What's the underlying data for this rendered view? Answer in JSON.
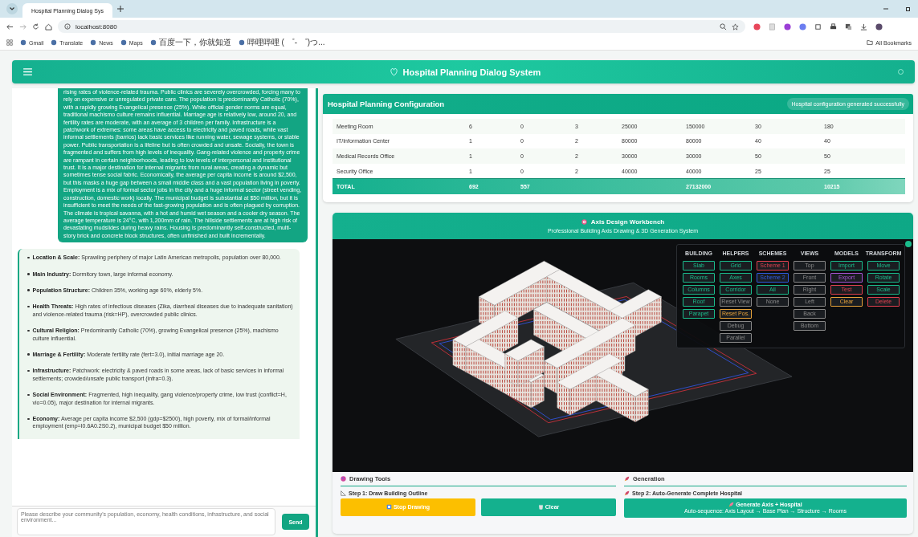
{
  "browser": {
    "tab_title": "Hospital Planning Dialog Sys",
    "address": "localhost:8080",
    "bookmarks": [
      {
        "label": "Gmail"
      },
      {
        "label": "Translate"
      },
      {
        "label": "News"
      },
      {
        "label": "Maps"
      },
      {
        "label": "百度一下，你就知道"
      },
      {
        "label": "哔哩哔哩 ( ゜- ゜)つ..."
      }
    ],
    "all_bookmarks": "All Bookmarks"
  },
  "app": {
    "title": "Hospital Planning Dialog System"
  },
  "chat": {
    "user_message": "rising rates of violence-related trauma. Public clinics are severely overcrowded, forcing many to rely on expensive or unregulated private care. The population is predominantly Catholic (70%), with a rapidly growing Evangelical presence (25%). While official gender norms are equal, traditional machismo culture remains influential. Marriage age is relatively low, around 20, and fertility rates are moderate, with an average of 3 children per family. Infrastructure is a patchwork of extremes: some areas have access to electricity and paved roads, while vast informal settlements (barrios) lack basic services like running water, sewage systems, or stable power. Public transportation is a lifeline but is often crowded and unsafe. Socially, the town is fragmented and suffers from high levels of inequality. Gang-related violence and property crime are rampant in certain neighborhoods, leading to low levels of interpersonal and institutional trust. It is a major destination for internal migrants from rural areas, creating a dynamic but sometimes tense social fabric. Economically, the average per capita income is around $2,500, but this masks a huge gap between a small middle class and a vast population living in poverty. Employment is a mix of formal sector jobs in the city and a huge informal sector (street vending, construction, domestic work) locally. The municipal budget is substantial at $50 million, but it is insufficient to meet the needs of the fast-growing population and is often plagued by corruption. The climate is tropical savanna, with a hot and humid wet season and a cooler dry season. The average temperature is 24°C, with 1,200mm of rain. The hillside settlements are at high risk of devastating mudslides during heavy rains. Housing is predominantly self-constructed, multi-story brick and concrete block structures, often unfinished and built incrementally.",
    "summary": [
      {
        "label": "Location & Scale:",
        "text": "Sprawling periphery of major Latin American metropolis, population over 80,000."
      },
      {
        "label": "Main Industry:",
        "text": "Dormitory town, large informal economy."
      },
      {
        "label": "Population Structure:",
        "text": "Children 35%, working age 60%, elderly 5%."
      },
      {
        "label": "Health Threats:",
        "text": "High rates of infectious diseases (Zika, diarrheal diseases due to inadequate sanitation) and violence-related trauma (risk=HP), overcrowded public clinics."
      },
      {
        "label": "Cultural Religion:",
        "text": "Predominantly Catholic (70%), growing Evangelical presence (25%), machismo culture influential."
      },
      {
        "label": "Marriage & Fertility:",
        "text": "Moderate fertility rate (fert=3.0), initial marriage age 20."
      },
      {
        "label": "Infrastructure:",
        "text": "Patchwork: electricity & paved roads in some areas, lack of basic services in informal settlements; crowded/unsafe public transport (infra=0.3)."
      },
      {
        "label": "Social Environment:",
        "text": "Fragmented, high inequality, gang violence/property crime, low trust (conflict=H, vio=0.05), major destination for internal migrants."
      },
      {
        "label": "Economy:",
        "text": "Average per capita income $2,500 (gdp=$2500), high poverty, mix of formal/informal employment (emp=I0.6A0.2S0.2), municipal budget $50 million."
      }
    ],
    "input": {
      "placeholder": "Please describe your community's population, economy, health conditions, infrastructure, and social environment..."
    },
    "send": "Send"
  },
  "config": {
    "title": "Hospital Planning Configuration",
    "status": "Hospital configuration generated successfully",
    "rows": [
      [
        "Meeting Room",
        "6",
        "0",
        "3",
        "25000",
        "150000",
        "30",
        "180"
      ],
      [
        "IT/Information Center",
        "1",
        "0",
        "2",
        "80000",
        "80000",
        "40",
        "40"
      ],
      [
        "Medical Records Office",
        "1",
        "0",
        "2",
        "30000",
        "30000",
        "50",
        "50"
      ],
      [
        "Security Office",
        "1",
        "0",
        "2",
        "40000",
        "40000",
        "25",
        "25"
      ]
    ],
    "total": {
      "column_1": "TOTAL",
      "column_2": "692",
      "column_3": "557",
      "column_6": "27132000",
      "column_8": "10215"
    }
  },
  "workbench": {
    "title": "Axis Design Workbench",
    "subtitle": "Professional Building Axis Drawing & 3D Generation System",
    "palette": [
      {
        "title": "BUILDING",
        "buttons": [
          {
            "label": "Slab",
            "color": "#1abc8c"
          },
          {
            "label": "Rooms",
            "color": "#1abc8c"
          },
          {
            "label": "Columns",
            "color": "#1abc8c"
          },
          {
            "label": "Roof",
            "color": "#1abc8c"
          },
          {
            "label": "Parapet",
            "color": "#1abc8c"
          }
        ]
      },
      {
        "title": "HELPERS",
        "buttons": [
          {
            "label": "Grid",
            "color": "#1abc8c"
          },
          {
            "label": "Axes",
            "color": "#1abc8c"
          },
          {
            "label": "Corridor",
            "color": "#1abc8c"
          },
          {
            "label": "Reset View",
            "color": "#888888"
          },
          {
            "label": "Reset Pos.",
            "color": "#e8a33a"
          },
          {
            "label": "Debug",
            "color": "#888888"
          },
          {
            "label": "Parallel",
            "color": "#888888"
          }
        ]
      },
      {
        "title": "SCHEMES",
        "buttons": [
          {
            "label": "Scheme 1",
            "color": "#e0404f"
          },
          {
            "label": "Scheme 2",
            "color": "#2f5be0"
          },
          {
            "label": "All",
            "color": "#1abc8c"
          },
          {
            "label": "None",
            "color": "#888888"
          }
        ]
      },
      {
        "title": "VIEWS",
        "buttons": [
          {
            "label": "Top",
            "color": "#888888"
          },
          {
            "label": "Front",
            "color": "#888888"
          },
          {
            "label": "Right",
            "color": "#888888"
          },
          {
            "label": "Left",
            "color": "#888888"
          },
          {
            "label": "Back",
            "color": "#888888"
          },
          {
            "label": "Bottom",
            "color": "#888888"
          }
        ]
      },
      {
        "title": "MODELS",
        "buttons": [
          {
            "label": "Import",
            "color": "#1abc8c"
          },
          {
            "label": "Export",
            "color": "#a855d8"
          },
          {
            "label": "Test",
            "color": "#e0404f"
          },
          {
            "label": "Clear",
            "color": "#e8a33a"
          }
        ]
      },
      {
        "title": "TRANSFORM",
        "buttons": [
          {
            "label": "Move",
            "color": "#1abc8c"
          },
          {
            "label": "Rotate",
            "color": "#1abc8c"
          },
          {
            "label": "Scale",
            "color": "#1abc8c"
          },
          {
            "label": "Delete",
            "color": "#e0404f"
          }
        ]
      }
    ],
    "drawing_tools": {
      "title": "Drawing Tools",
      "step": "Step 1: Draw Building Outline",
      "stop": "Stop Drawing",
      "clear": "Clear"
    },
    "generation": {
      "title": "Generation",
      "step": "Step 2: Auto-Generate Complete Hospital",
      "button": "Generate Axis + Hospital",
      "button_sub": "Auto-sequence: Axis Layout → Base Plan → Structure → Rooms"
    }
  }
}
